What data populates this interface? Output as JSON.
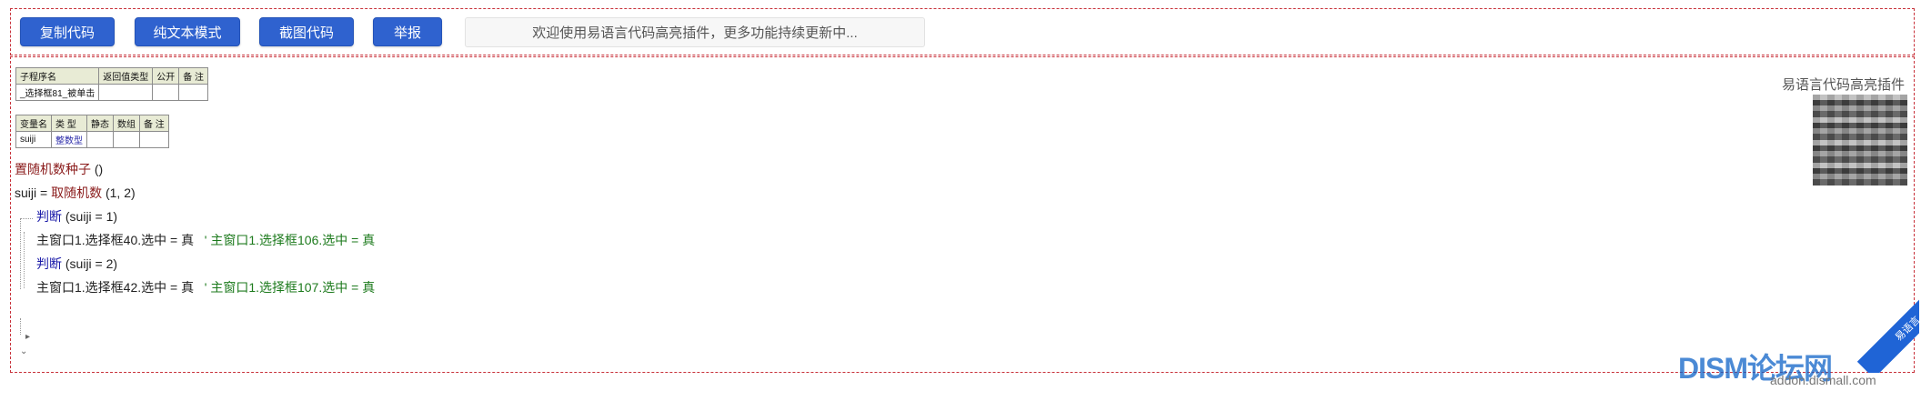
{
  "toolbar": {
    "copy_code": "复制代码",
    "plain_text_mode": "纯文本模式",
    "screenshot_code": "截图代码",
    "report": "举报",
    "notice": "欢迎使用易语言代码高亮插件，更多功能持续更新中..."
  },
  "subprogram_table": {
    "headers": [
      "子程序名",
      "返回值类型",
      "公开",
      "备 注"
    ],
    "row": [
      "_选择框81_被单击",
      "",
      "",
      ""
    ]
  },
  "variable_table": {
    "headers": [
      "变量名",
      "类 型",
      "静态",
      "数组",
      "备 注"
    ],
    "row": [
      "suiji",
      "整数型",
      "",
      "",
      ""
    ]
  },
  "code": {
    "line1_fn": "置随机数种子",
    "line1_args": " ()",
    "line2_var": "suiji = ",
    "line2_fn": "取随机数",
    "line2_args": " (1, 2)",
    "line3_kw": "判断",
    "line3_cond": " (suiji = 1)",
    "line4_stmt": "主窗口1.选择框40.选中 = 真",
    "line4_comment": "' 主窗口1.选择框106.选中 = 真",
    "line5_kw": "判断",
    "line5_cond": " (suiji = 2)",
    "line6_stmt": "主窗口1.选择框42.选中 = 真",
    "line6_comment": "' 主窗口1.选择框107.选中 = 真"
  },
  "plugin": {
    "label": "易语言代码高亮插件",
    "qr_icon": "qr-code"
  },
  "ribbon_text": "易语言",
  "watermark": {
    "logo": "DISM论坛网",
    "url": "addon.dismall.com"
  },
  "colors": {
    "button_blue": "#2f62cf",
    "function_red": "#8a1a1a",
    "keyword_blue": "#1a1aa8",
    "comment_green": "#1c7a1c",
    "frame_red": "#c8313a"
  }
}
